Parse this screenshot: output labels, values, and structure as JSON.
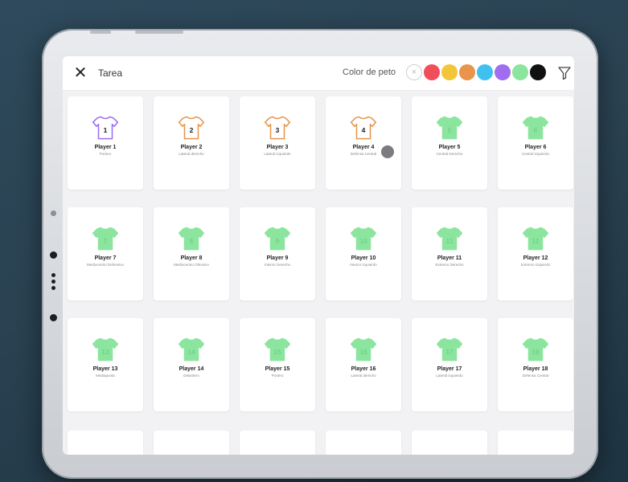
{
  "topbar": {
    "title": "Tarea",
    "color_label": "Color de peto",
    "swatches": [
      {
        "name": "none",
        "color": "#ffffff"
      },
      {
        "name": "red",
        "color": "#f04e5a"
      },
      {
        "name": "yellow",
        "color": "#f3c53a"
      },
      {
        "name": "orange",
        "color": "#e9944a"
      },
      {
        "name": "blue",
        "color": "#3fc1f0"
      },
      {
        "name": "purple",
        "color": "#a06cf0"
      },
      {
        "name": "green",
        "color": "#8ce59e"
      },
      {
        "name": "black",
        "color": "#111111"
      }
    ]
  },
  "players": [
    {
      "number": "1",
      "name": "Player 1",
      "position": "Portero",
      "color": "#9b6cf0"
    },
    {
      "number": "2",
      "name": "Player 2",
      "position": "Lateral derecho",
      "color": "#e9944a"
    },
    {
      "number": "3",
      "name": "Player 3",
      "position": "Lateral izquierdo",
      "color": "#e9944a"
    },
    {
      "number": "4",
      "name": "Player 4",
      "position": "Defensa Central",
      "color": "#e9944a"
    },
    {
      "number": "5",
      "name": "Player 5",
      "position": "Central Derecho",
      "color": "#8ce59e"
    },
    {
      "number": "6",
      "name": "Player 6",
      "position": "Central izquierdo",
      "color": "#8ce59e"
    },
    {
      "number": "7",
      "name": "Player 7",
      "position": "Mediocentro Defensivo",
      "color": "#8ce59e"
    },
    {
      "number": "8",
      "name": "Player 8",
      "position": "Mediocentro Ofensivo",
      "color": "#8ce59e"
    },
    {
      "number": "9",
      "name": "Player 9",
      "position": "Interior Derecho",
      "color": "#8ce59e"
    },
    {
      "number": "10",
      "name": "Player 10",
      "position": "Interior izquierdo",
      "color": "#8ce59e"
    },
    {
      "number": "11",
      "name": "Player 11",
      "position": "Extremo Derecho",
      "color": "#8ce59e"
    },
    {
      "number": "12",
      "name": "Player 12",
      "position": "Extremo izquierdo",
      "color": "#8ce59e"
    },
    {
      "number": "13",
      "name": "Player 13",
      "position": "Mediapunta",
      "color": "#8ce59e"
    },
    {
      "number": "14",
      "name": "Player 14",
      "position": "Delantero",
      "color": "#8ce59e"
    },
    {
      "number": "15",
      "name": "Player 15",
      "position": "Portero",
      "color": "#8ce59e"
    },
    {
      "number": "16",
      "name": "Player 16",
      "position": "Lateral derecho",
      "color": "#8ce59e"
    },
    {
      "number": "17",
      "name": "Player 17",
      "position": "Lateral izquierdo",
      "color": "#8ce59e"
    },
    {
      "number": "18",
      "name": "Player 18",
      "position": "Defensa Central",
      "color": "#8ce59e"
    }
  ]
}
